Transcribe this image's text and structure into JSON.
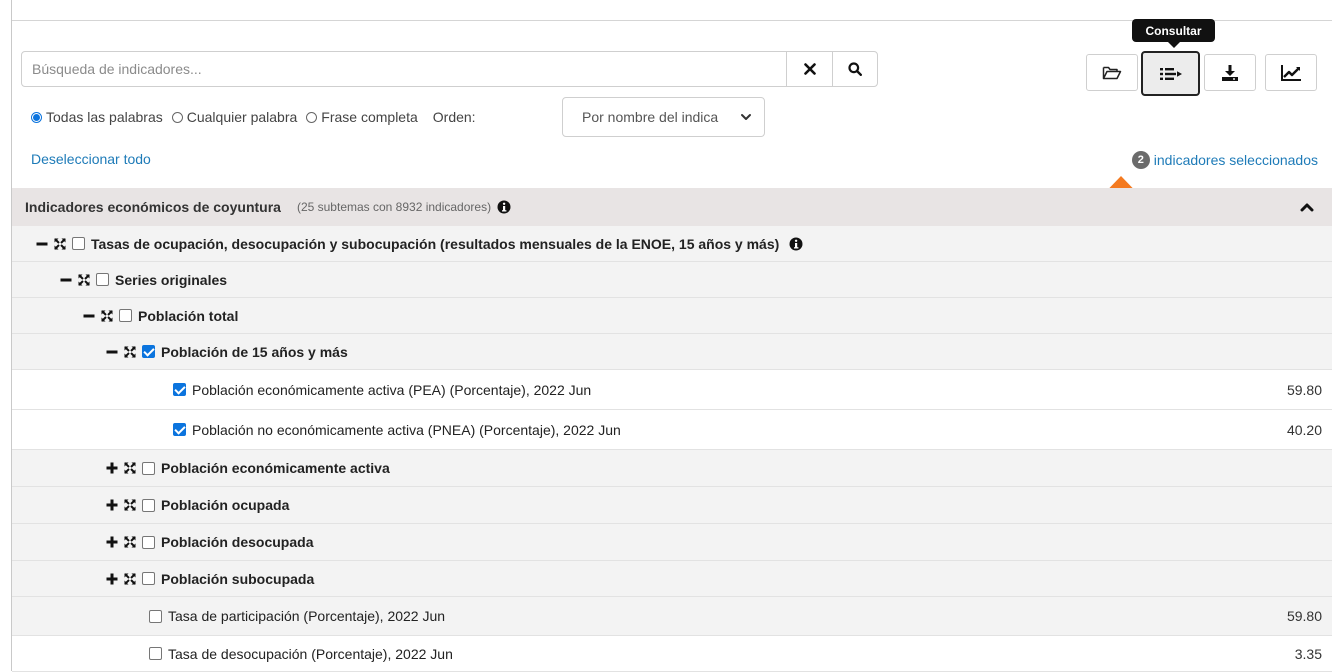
{
  "search": {
    "placeholder": "Búsqueda de indicadores...",
    "clear_icon": "times-icon",
    "search_icon": "search-icon"
  },
  "toolbar": {
    "tooltip": "Consultar",
    "buttons": [
      "folder-open-icon",
      "list-arrow-icon",
      "download-icon",
      "chart-line-icon"
    ],
    "active_button": "list-arrow-icon"
  },
  "options": {
    "radios": [
      {
        "label": "Todas las palabras",
        "checked": true
      },
      {
        "label": "Cualquier palabra",
        "checked": false
      },
      {
        "label": "Frase completa",
        "checked": false
      }
    ],
    "order_label": "Orden:",
    "order_value": "Por nombre del indica"
  },
  "selection": {
    "deselect_label": "Deseleccionar todo",
    "count": "2",
    "count_label": "indicadores seleccionados"
  },
  "colors": {
    "accent": "#0b74de",
    "link": "#1e7bb8",
    "arrow": "#f47a20",
    "header_bg": "#e8e4e4"
  },
  "tree": {
    "header": {
      "title": "Indicadores económicos de coyuntura",
      "subtitle": "(25 subtemas con 8932 indicadores)"
    },
    "rows": [
      {
        "level": 0,
        "toggle": "minus",
        "checked": false,
        "bold": true,
        "label": "Tasas de ocupación, desocupación y subocupación (resultados mensuales de la ENOE, 15 años y más)",
        "info": true,
        "value": ""
      },
      {
        "level": 1,
        "toggle": "minus",
        "checked": false,
        "bold": true,
        "label": "Series originales",
        "value": ""
      },
      {
        "level": 2,
        "toggle": "minus",
        "checked": false,
        "bold": true,
        "label": "Población total",
        "value": ""
      },
      {
        "level": 3,
        "toggle": "minus",
        "checked": true,
        "bold": true,
        "label": "Población de 15 años y más",
        "value": ""
      },
      {
        "level": 4,
        "toggle": "none",
        "checked": true,
        "bold": false,
        "label": "Población económicamente activa (PEA) (Porcentaje), 2022 Jun",
        "value": "59.80"
      },
      {
        "level": 4,
        "toggle": "none",
        "checked": true,
        "bold": false,
        "label": "Población no económicamente activa (PNEA) (Porcentaje), 2022 Jun",
        "value": "40.20"
      },
      {
        "level": 3,
        "toggle": "plus",
        "checked": false,
        "bold": true,
        "label": "Población económicamente activa",
        "value": ""
      },
      {
        "level": 3,
        "toggle": "plus",
        "checked": false,
        "bold": true,
        "label": "Población ocupada",
        "value": ""
      },
      {
        "level": 3,
        "toggle": "plus",
        "checked": false,
        "bold": true,
        "label": "Población desocupada",
        "value": ""
      },
      {
        "level": 3,
        "toggle": "plus",
        "checked": false,
        "bold": true,
        "label": "Población subocupada",
        "value": ""
      },
      {
        "level": 3,
        "toggle": "none",
        "checked": false,
        "bold": false,
        "label": "Tasa de participación (Porcentaje), 2022 Jun",
        "value": "59.80"
      },
      {
        "level": 3,
        "toggle": "none",
        "checked": false,
        "bold": false,
        "label": "Tasa de desocupación (Porcentaje), 2022 Jun",
        "value": "3.35"
      }
    ]
  }
}
